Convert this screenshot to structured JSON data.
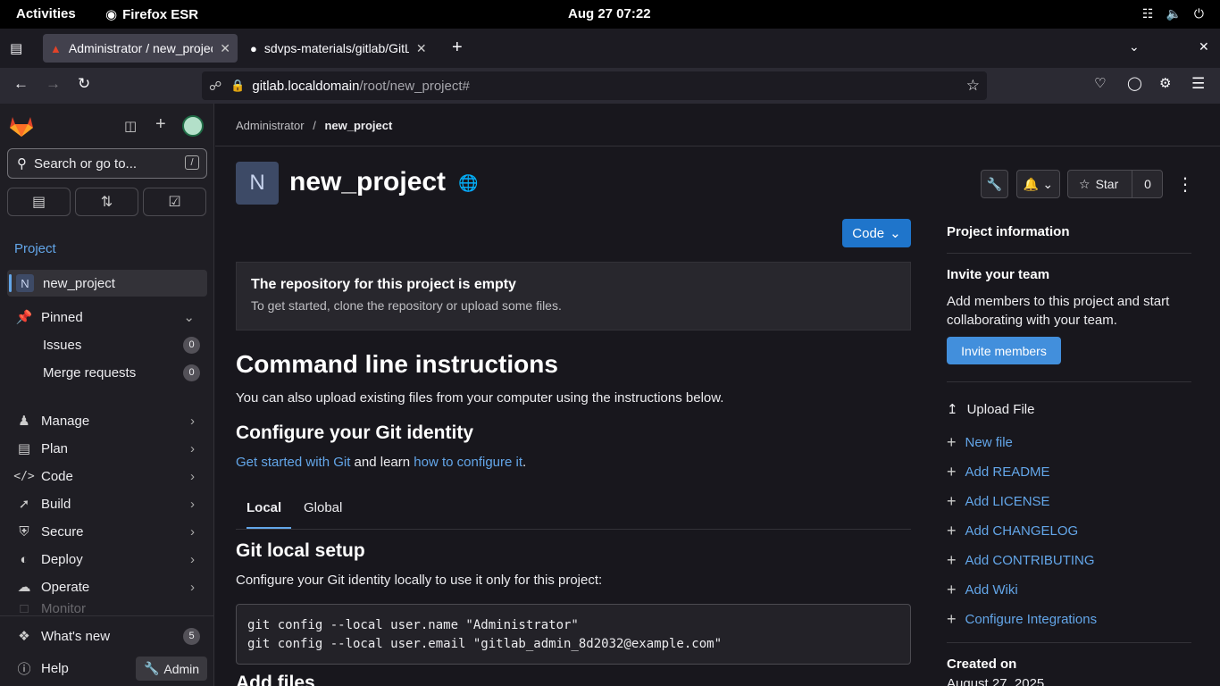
{
  "os": {
    "activities": "Activities",
    "app_name": "Firefox ESR",
    "clock": "Aug 27  07:22"
  },
  "browser": {
    "tabs": [
      {
        "title": "Administrator / new_project"
      },
      {
        "title": "sdvps-materials/gitlab/GitLab"
      }
    ],
    "url_host": "gitlab.localdomain",
    "url_path": "/root/new_project#"
  },
  "sidebar": {
    "search_placeholder": "Search or go to...",
    "search_shortcut": "/",
    "section_label": "Project",
    "project_avatar": "N",
    "project_name": "new_project",
    "pinned_label": "Pinned",
    "pinned_items": [
      {
        "label": "Issues",
        "count": "0"
      },
      {
        "label": "Merge requests",
        "count": "0"
      }
    ],
    "nav": [
      {
        "label": "Manage"
      },
      {
        "label": "Plan"
      },
      {
        "label": "Code"
      },
      {
        "label": "Build"
      },
      {
        "label": "Secure"
      },
      {
        "label": "Deploy"
      },
      {
        "label": "Operate"
      },
      {
        "label": "Monitor"
      }
    ],
    "whats_new": "What's new",
    "whats_new_count": "5",
    "help": "Help",
    "admin": "Admin"
  },
  "main": {
    "breadcrumb_root": "Administrator",
    "breadcrumb_sep": "/",
    "breadcrumb_current": "new_project",
    "avatar_letter": "N",
    "title": "new_project",
    "star_label": "Star",
    "star_count": "0",
    "code_button": "Code",
    "empty_title": "The repository for this project is empty",
    "empty_text": "To get started, clone the repository or upload some files.",
    "cli_title": "Command line instructions",
    "cli_text": "You can also upload existing files from your computer using the instructions below.",
    "identity_title": "Configure your Git identity",
    "identity_link1": "Get started with Git",
    "identity_mid": " and learn ",
    "identity_link2": "how to configure it",
    "identity_end": ".",
    "tab_local": "Local",
    "tab_global": "Global",
    "local_title": "Git local setup",
    "local_text": "Configure your Git identity locally to use it only for this project:",
    "code_line1": "git config --local user.name \"Administrator\"",
    "code_line2": "git config --local user.email \"gitlab_admin_8d2032@example.com\"",
    "add_files": "Add files"
  },
  "right_panel": {
    "project_info": "Project information",
    "invite_title": "Invite your team",
    "invite_text": "Add members to this project and start collaborating with your team.",
    "invite_button": "Invite members",
    "upload_file": "Upload File",
    "actions": [
      "New file",
      "Add README",
      "Add LICENSE",
      "Add CHANGELOG",
      "Add CONTRIBUTING",
      "Add Wiki",
      "Configure Integrations"
    ],
    "created_on": "Created on",
    "created_date": "August 27, 2025"
  },
  "colors": {
    "link": "#63a6e9",
    "primary_button": "#1f75cb",
    "invite_button": "#428fdc"
  }
}
